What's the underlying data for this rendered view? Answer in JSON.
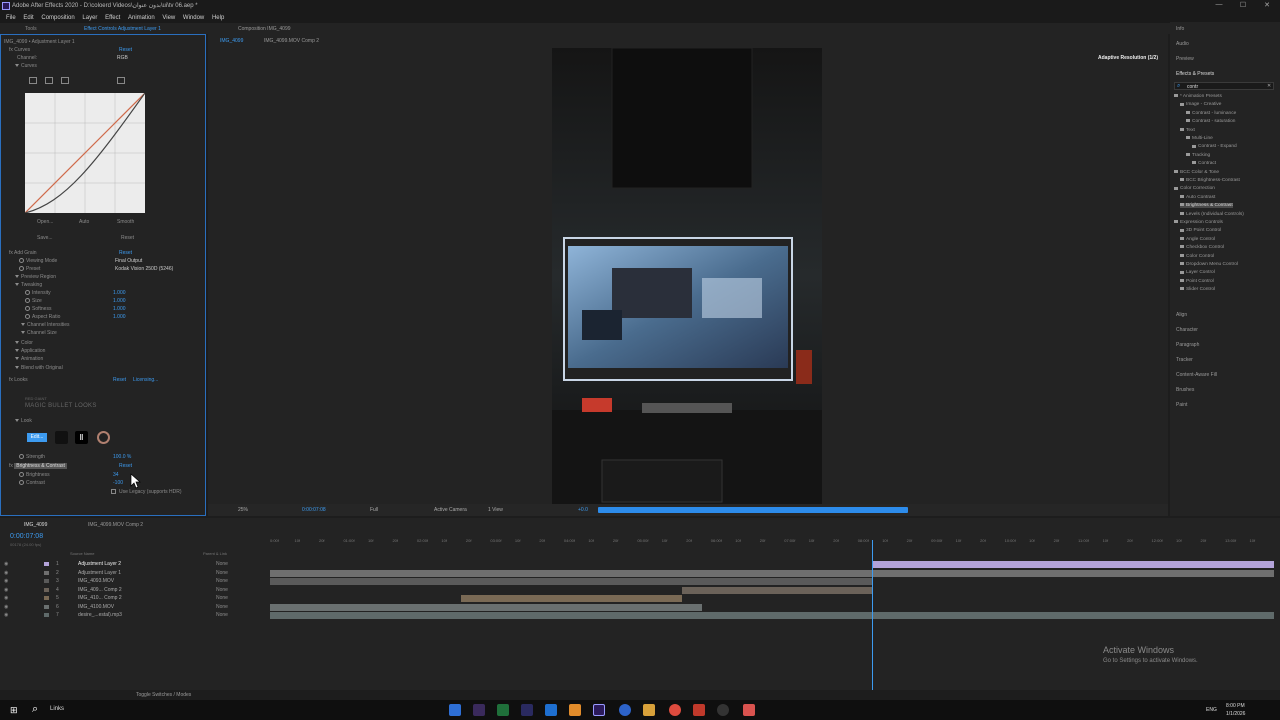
{
  "window": {
    "title": "Adobe After Effects 2020 - D:\\coloerd Videos\\بدون عنوان\\ui\\tv 06.aep *",
    "minimize": "—",
    "maximize": "☐",
    "close": "✕"
  },
  "menu": [
    "File",
    "Edit",
    "Composition",
    "Layer",
    "Effect",
    "Animation",
    "View",
    "Window",
    "Help"
  ],
  "effects_panel": {
    "tab_tools": "Tools",
    "tab_label": "Effect Controls Adjustment Layer 1",
    "layer_path": "IMG_4099 • Adjustment Layer 1",
    "curves": {
      "name": "Curves",
      "reset": "Reset",
      "channel_label": "Channel:",
      "channel_value": "RGB",
      "group": "Curves",
      "open": "Open...",
      "auto": "Auto",
      "smooth": "Smooth",
      "save": "Save...",
      "reset2": "Reset"
    },
    "grain": {
      "name": "Add Grain",
      "reset": "Reset",
      "viewing_mode_label": "Viewing Mode",
      "viewing_mode_value": "Final Output",
      "preset_label": "Preset",
      "preset_value": "Kodak Vision 250D (5246)",
      "preview_region": "Preview Region",
      "tweaking": "Tweaking",
      "params": [
        {
          "name": "Intensity",
          "value": "1.000"
        },
        {
          "name": "Size",
          "value": "1.000"
        },
        {
          "name": "Softness",
          "value": "1.000"
        },
        {
          "name": "Aspect Ratio",
          "value": "1.000"
        }
      ],
      "channel_intensities": "Channel Intensities",
      "channel_size": "Channel Size",
      "groups": [
        "Color",
        "Application",
        "Animation"
      ],
      "blend": "Blend with Original"
    },
    "looks": {
      "name": "Looks",
      "reset": "Reset",
      "licensing": "Licensing...",
      "brand_small": "RED GIANT",
      "brand": "MAGIC BULLET LOOKS",
      "look": "Look",
      "edit": "Edit...",
      "strength_label": "Strength",
      "strength_value": "100.0 %"
    },
    "brightness": {
      "name": "Brightness & Contrast",
      "reset": "Reset",
      "brightness_label": "Brightness",
      "brightness_value": "34",
      "contrast_label": "Contrast",
      "contrast_value": "-100",
      "legacy": "Use Legacy (supports HDR)"
    }
  },
  "composition": {
    "tab_label": "Composition IMG_4099",
    "crumb1": "IMG_4099",
    "crumb2": "IMG_4099.MOV Comp 2",
    "adaptive": "Adaptive Resolution (1/2)",
    "zoom": "25%",
    "time": "0:00:07:08",
    "quality": "Full",
    "camera": "Active Camera",
    "view": "1 View",
    "exposure": "+0.0",
    "render_progress": 0.55
  },
  "right_panel": {
    "info": "Info",
    "audio": "Audio",
    "preview": "Preview",
    "effects_presets": "Effects & Presets",
    "search": "contr",
    "tree": [
      {
        "label": "* Animation Presets",
        "indent": 0
      },
      {
        "label": "Image - Creative",
        "indent": 1
      },
      {
        "label": "Contrast - luminance",
        "indent": 2
      },
      {
        "label": "Contrast - saturation",
        "indent": 2
      },
      {
        "label": "Text",
        "indent": 1
      },
      {
        "label": "Multi-Line",
        "indent": 2
      },
      {
        "label": "Contrast - Expand",
        "indent": 3
      },
      {
        "label": "Tracking",
        "indent": 2
      },
      {
        "label": "Contract",
        "indent": 3
      },
      {
        "label": "BCC Color & Tone",
        "indent": 0
      },
      {
        "label": "BCC Brightness-Contrast",
        "indent": 1
      },
      {
        "label": "Color Correction",
        "indent": 0
      },
      {
        "label": "Auto Contrast",
        "indent": 1
      },
      {
        "label": "Brightness & Contrast",
        "indent": 1,
        "selected": true
      },
      {
        "label": "Levels (Individual Controls)",
        "indent": 1
      },
      {
        "label": "Expression Controls",
        "indent": 0
      },
      {
        "label": "3D Point Control",
        "indent": 1
      },
      {
        "label": "Angle Control",
        "indent": 1
      },
      {
        "label": "Checkbox Control",
        "indent": 1
      },
      {
        "label": "Color Control",
        "indent": 1
      },
      {
        "label": "Dropdown Menu Control",
        "indent": 1
      },
      {
        "label": "Layer Control",
        "indent": 1
      },
      {
        "label": "Point Control",
        "indent": 1
      },
      {
        "label": "Slider Control",
        "indent": 1
      }
    ],
    "panels": [
      "Align",
      "Character",
      "Paragraph",
      "Tracker",
      "Content-Aware Fill",
      "Brushes",
      "Paint"
    ]
  },
  "timeline": {
    "tab1": "IMG_4099",
    "tab2": "IMG_4099.MOV Comp 2",
    "timecode": "0:00:07:08",
    "frames": "00178 (24.00 fps)",
    "col_source": "Source Name",
    "col_parent": "Parent & Link",
    "ruler": [
      "0:00f",
      "10f",
      "20f",
      "01:00f",
      "10f",
      "20f",
      "02:00f",
      "10f",
      "20f",
      "03:00f",
      "10f",
      "20f",
      "04:00f",
      "10f",
      "20f",
      "05:00f",
      "10f",
      "20f",
      "06:00f",
      "10f",
      "20f",
      "07:00f",
      "10f",
      "20f",
      "08:00f",
      "10f",
      "20f",
      "09:00f",
      "10f",
      "20f",
      "10:00f",
      "10f",
      "20f",
      "11:00f",
      "10f",
      "20f",
      "12:00f",
      "10f",
      "20f",
      "13:00f",
      "10f"
    ],
    "layers": [
      {
        "num": "1",
        "name": "Adjustment Layer 2",
        "parent": "None",
        "color": "#b3a3d9",
        "start": 0.6,
        "end": 1.0
      },
      {
        "num": "2",
        "name": "Adjustment Layer 1",
        "parent": "None",
        "color": "#6f6f6f",
        "start": 0.0,
        "end": 1.0
      },
      {
        "num": "3",
        "name": "IMG_4093.MOV",
        "parent": "None",
        "color": "#5a5a5a",
        "start": 0.0,
        "end": 0.6
      },
      {
        "num": "4",
        "name": "IMG_409... Comp 2",
        "parent": "None",
        "color": "#6b6259",
        "start": 0.41,
        "end": 0.6
      },
      {
        "num": "5",
        "name": "IMG_410... Comp 2",
        "parent": "None",
        "color": "#7a6a55",
        "start": 0.19,
        "end": 0.41
      },
      {
        "num": "6",
        "name": "IMG_4100.MOV",
        "parent": "None",
        "color": "#6a7070",
        "start": 0.0,
        "end": 0.43
      },
      {
        "num": "7",
        "name": "desire_...estal).mp3",
        "parent": "None",
        "color": "#5f6a6a",
        "start": 0.0,
        "end": 1.0
      }
    ],
    "switches": "Toggle Switches / Modes",
    "links": "Links",
    "playhead": 0.6
  },
  "watermark": {
    "title": "Activate Windows",
    "sub": "Go to Settings to activate Windows."
  },
  "taskbar": {
    "lang": "ENG",
    "time": "8:00 PM",
    "date": "1/1/2026"
  }
}
